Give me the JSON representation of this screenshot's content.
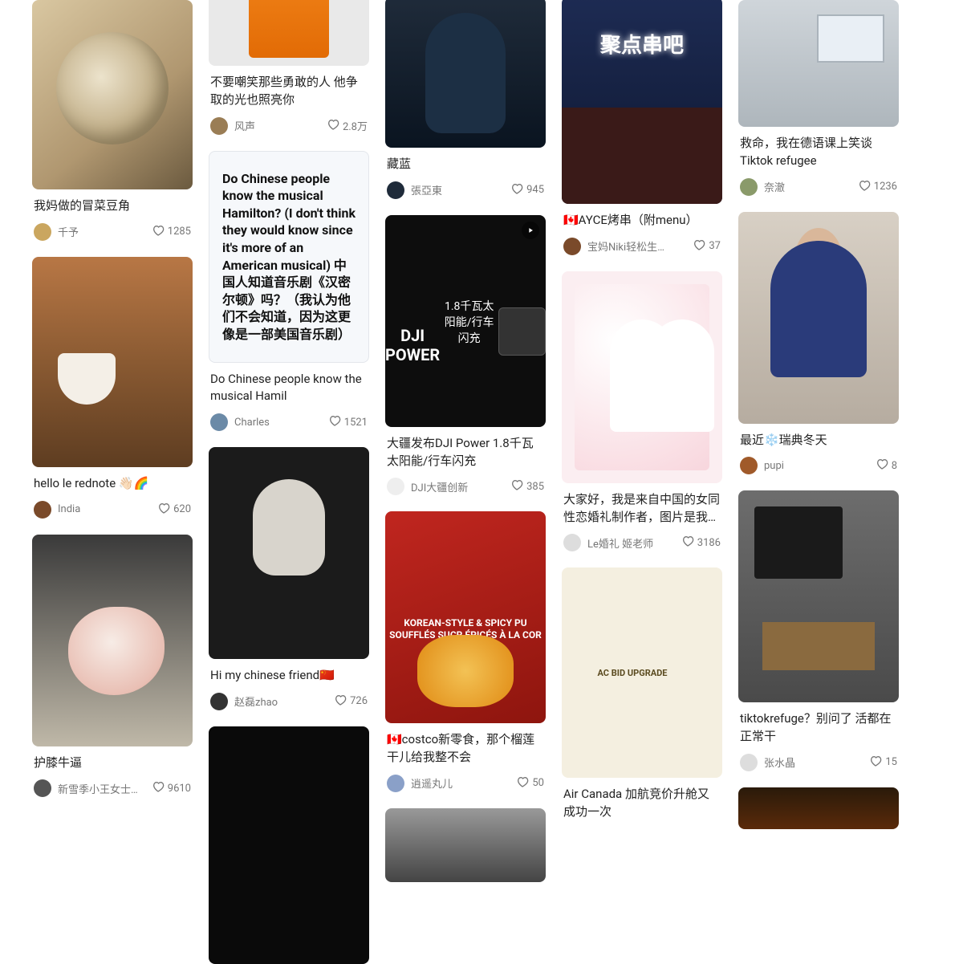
{
  "columns": [
    [
      {
        "id": "c0p0",
        "thumbClass": "t-food1",
        "title": "我妈做的冒菜豆角",
        "author": "千予",
        "likes": "1285",
        "avatar": "#caa65f"
      },
      {
        "id": "c0p1",
        "thumbClass": "t-coffee",
        "title": "hello le rednote 👋🏻🌈",
        "author": "India",
        "likes": "620",
        "avatar": "#7a4a2a"
      },
      {
        "id": "c0p2",
        "thumbClass": "t-knee",
        "title": "护膝牛逼",
        "author": "新雪季小王女士不…",
        "likes": "9610",
        "avatar": "#555"
      }
    ],
    [
      {
        "id": "c1p0",
        "thumbClass": "t-orange",
        "offsetTop": -82,
        "title": "不要嘲笑那些勇敢的人 他争取的光也照亮你",
        "author": "风声",
        "likes": "2.8万",
        "avatar": "#9a7d55"
      },
      {
        "id": "c1p1",
        "thumbClass": "t-textcard",
        "textOverlay": "Do Chinese people know the musical Hamilton? (I don't think they would know since it's more of an American musical)   中国人知道音乐剧《汉密尔顿》吗？（我认为他们不会知道，因为这更像是一部美国音乐剧）",
        "title": "Do Chinese people know the musical Hamil",
        "author": "Charles",
        "likes": "1521",
        "avatar": "#6b8aa7"
      },
      {
        "id": "c1p2",
        "thumbClass": "t-bw",
        "title": "Hi my chinese friend🇨🇳",
        "author": "赵磊zhao",
        "likes": "726",
        "avatar": "#333"
      },
      {
        "id": "c1p3",
        "thumbClass": "t-blackperson",
        "noMeta": true
      }
    ],
    [
      {
        "id": "c2p0",
        "thumbClass": "t-portrait",
        "offsetTop": -4,
        "title": "藏蓝",
        "author": "張亞東",
        "likes": "945",
        "avatar": "#1f2b3a"
      },
      {
        "id": "c2p1",
        "thumbClass": "t-dji",
        "hasPlay": true,
        "djiTitle": "DJI POWER",
        "djiSub": "1.8千瓦太阳能/行车闪充",
        "title": "大疆发布DJI Power 1.8千瓦太阳能/行车闪充",
        "author": "DJI大疆创新",
        "likes": "385",
        "avatar": "#eee"
      },
      {
        "id": "c2p2",
        "thumbClass": "t-snack",
        "bagText": "KOREAN-STYLE\n & SPICY PU\nSOUFFLÉS SUCR\nÉPICÉS À LA COR",
        "title": "🇨🇦costco新零食，那个榴莲干儿给我整不会",
        "author": "逍遥丸儿",
        "likes": "50",
        "avatar": "#8aa0c8"
      },
      {
        "id": "c2p3",
        "thumbClass": "t-grad",
        "noMeta": true
      }
    ],
    [
      {
        "id": "c3p0",
        "thumbClass": "t-store",
        "offsetTop": -4,
        "signText": "聚点串吧",
        "title": "🇨🇦AYCE烤串（附menu）",
        "author": "宝妈Niki轻松生活",
        "likes": "37",
        "avatar": "#7a4a2a"
      },
      {
        "id": "c3p1",
        "thumbClass": "t-wedding",
        "title": "大家好，我是来自中国的女同性恋婚礼制作者，图片是我…",
        "author": "Le婚礼 姬老师",
        "likes": "3186",
        "avatar": "#ddd"
      },
      {
        "id": "c3p2",
        "thumbClass": "t-doc",
        "docHead": "AC BID UPGRADE",
        "title": "Air Canada 加航竞价升舱又成功一次",
        "noMeta": true
      }
    ],
    [
      {
        "id": "c4p0",
        "thumbClass": "t-office1",
        "title": "救命，我在德语课上笑谈Tiktok refugee",
        "author": "奈澈",
        "likes": "1236",
        "avatar": "#8a9a6a"
      },
      {
        "id": "c4p1",
        "thumbClass": "t-selfie",
        "title": "最近❄️瑞典冬天",
        "author": "pupi",
        "likes": "8",
        "avatar": "#a05a2a"
      },
      {
        "id": "c4p2",
        "thumbClass": "t-office2",
        "title": "tiktokrefuge？别问了 活都在正常干",
        "author": "张水晶",
        "likes": "15",
        "avatar": "#ddd"
      },
      {
        "id": "c4p3",
        "thumbClass": "t-dark",
        "noMeta": true
      }
    ]
  ]
}
